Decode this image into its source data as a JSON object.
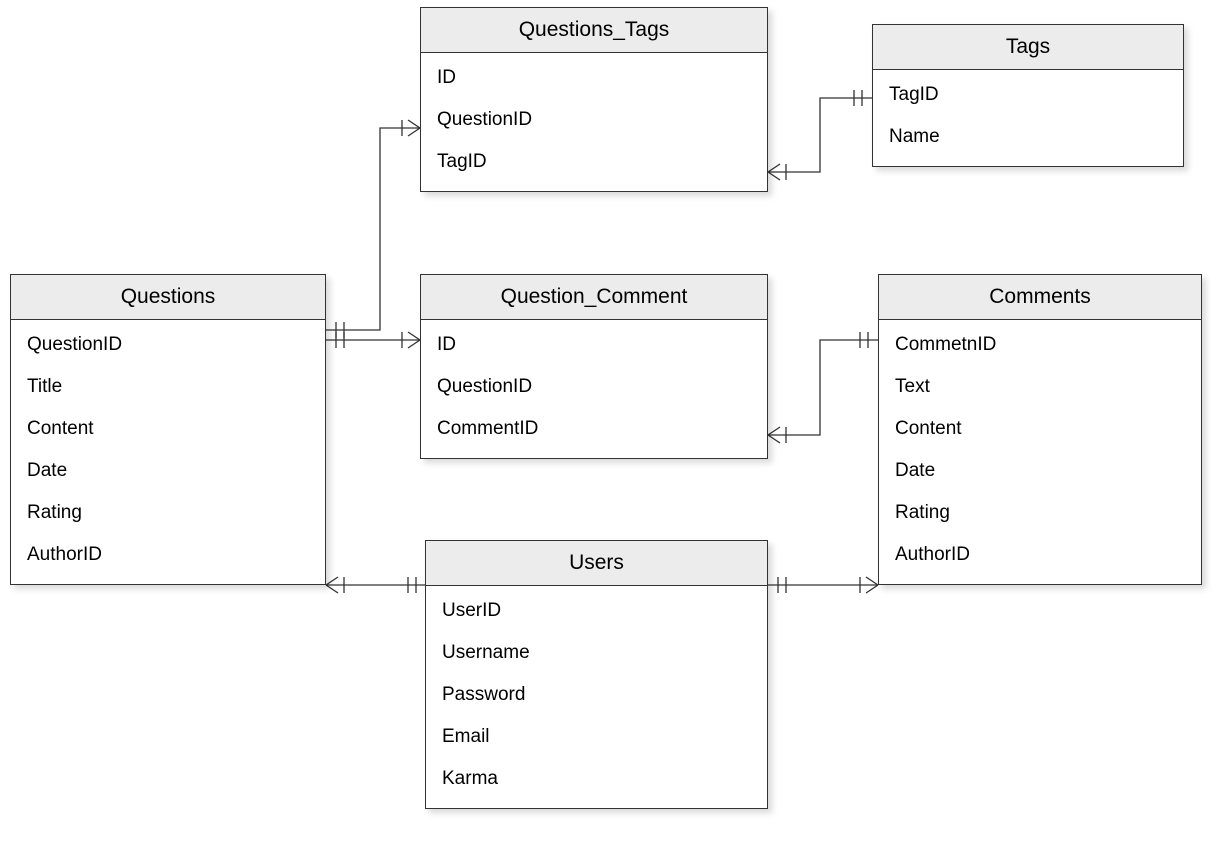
{
  "entities": {
    "questions": {
      "title": "Questions",
      "fields": [
        "QuestionID",
        "Title",
        "Content",
        "Date",
        "Rating",
        "AuthorID"
      ]
    },
    "questions_tags": {
      "title": "Questions_Tags",
      "fields": [
        "ID",
        "QuestionID",
        "TagID"
      ]
    },
    "tags": {
      "title": "Tags",
      "fields": [
        "TagID",
        "Name"
      ]
    },
    "question_comment": {
      "title": "Question_Comment",
      "fields": [
        "ID",
        "QuestionID",
        "CommentID"
      ]
    },
    "comments": {
      "title": "Comments",
      "fields": [
        "CommetnID",
        "Text",
        "Content",
        "Date",
        "Rating",
        "AuthorID"
      ]
    },
    "users": {
      "title": "Users",
      "fields": [
        "UserID",
        "Username",
        "Password",
        "Email",
        "Karma"
      ]
    }
  },
  "relationships": [
    {
      "from": "questions",
      "to": "questions_tags",
      "type": "one-to-many"
    },
    {
      "from": "questions",
      "to": "question_comment",
      "type": "one-to-many"
    },
    {
      "from": "questions_tags",
      "to": "tags",
      "type": "many-to-one"
    },
    {
      "from": "question_comment",
      "to": "comments",
      "type": "many-to-one"
    },
    {
      "from": "users",
      "to": "questions",
      "type": "one-to-many"
    },
    {
      "from": "users",
      "to": "comments",
      "type": "one-to-many"
    }
  ]
}
